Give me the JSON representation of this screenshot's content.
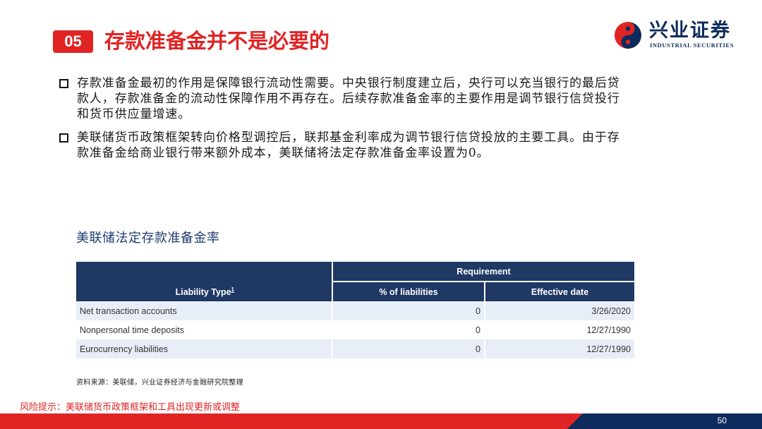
{
  "header": {
    "section_number": "05",
    "title": "存款准备金并不是必要的"
  },
  "logo": {
    "name_cn": "兴业证券",
    "name_en": "INDUSTRIAL SECURITIES",
    "colors": {
      "navy": "#0d2b5c",
      "red": "#e02424"
    }
  },
  "bullets": [
    {
      "text": "存款准备金最初的作用是保障银行流动性需要。中央银行制度建立后，央行可以充当银行的最后贷款人，存款准备金的流动性保障作用不再存在。后续存款准备金率的主要作用是调节银行信贷投行和货币供应量增速。"
    },
    {
      "text": "美联储货币政策框架转向价格型调控后，联邦基金利率成为调节银行信贷投放的主要工具。由于存款准备金给商业银行带来额外成本，美联储将法定存款准备金率设置为0。"
    }
  ],
  "table": {
    "title": "美联储法定存款准备金率",
    "group_header": "Requirement",
    "columns": {
      "liability": "Liability Type",
      "liability_sup": "1",
      "pct": "% of liabilities",
      "date": "Effective date"
    },
    "rows": [
      {
        "type": "Net transaction accounts",
        "pct": "0",
        "date": "3/26/2020"
      },
      {
        "type": "Nonpersonal time deposits",
        "pct": "0",
        "date": "12/27/1990"
      },
      {
        "type": "Eurocurrency liabilities",
        "pct": "0",
        "date": "12/27/1990"
      }
    ]
  },
  "source_note": "资料来源：美联储，兴业证券经济与金融研究院整理",
  "risk_note": "风险提示：美联储货币政策框架和工具出现更新或调整",
  "page_number": "50",
  "theme": {
    "accent_red": "#e02424",
    "header_navy": "#1f3864",
    "row_alt": "#e8eef7"
  }
}
